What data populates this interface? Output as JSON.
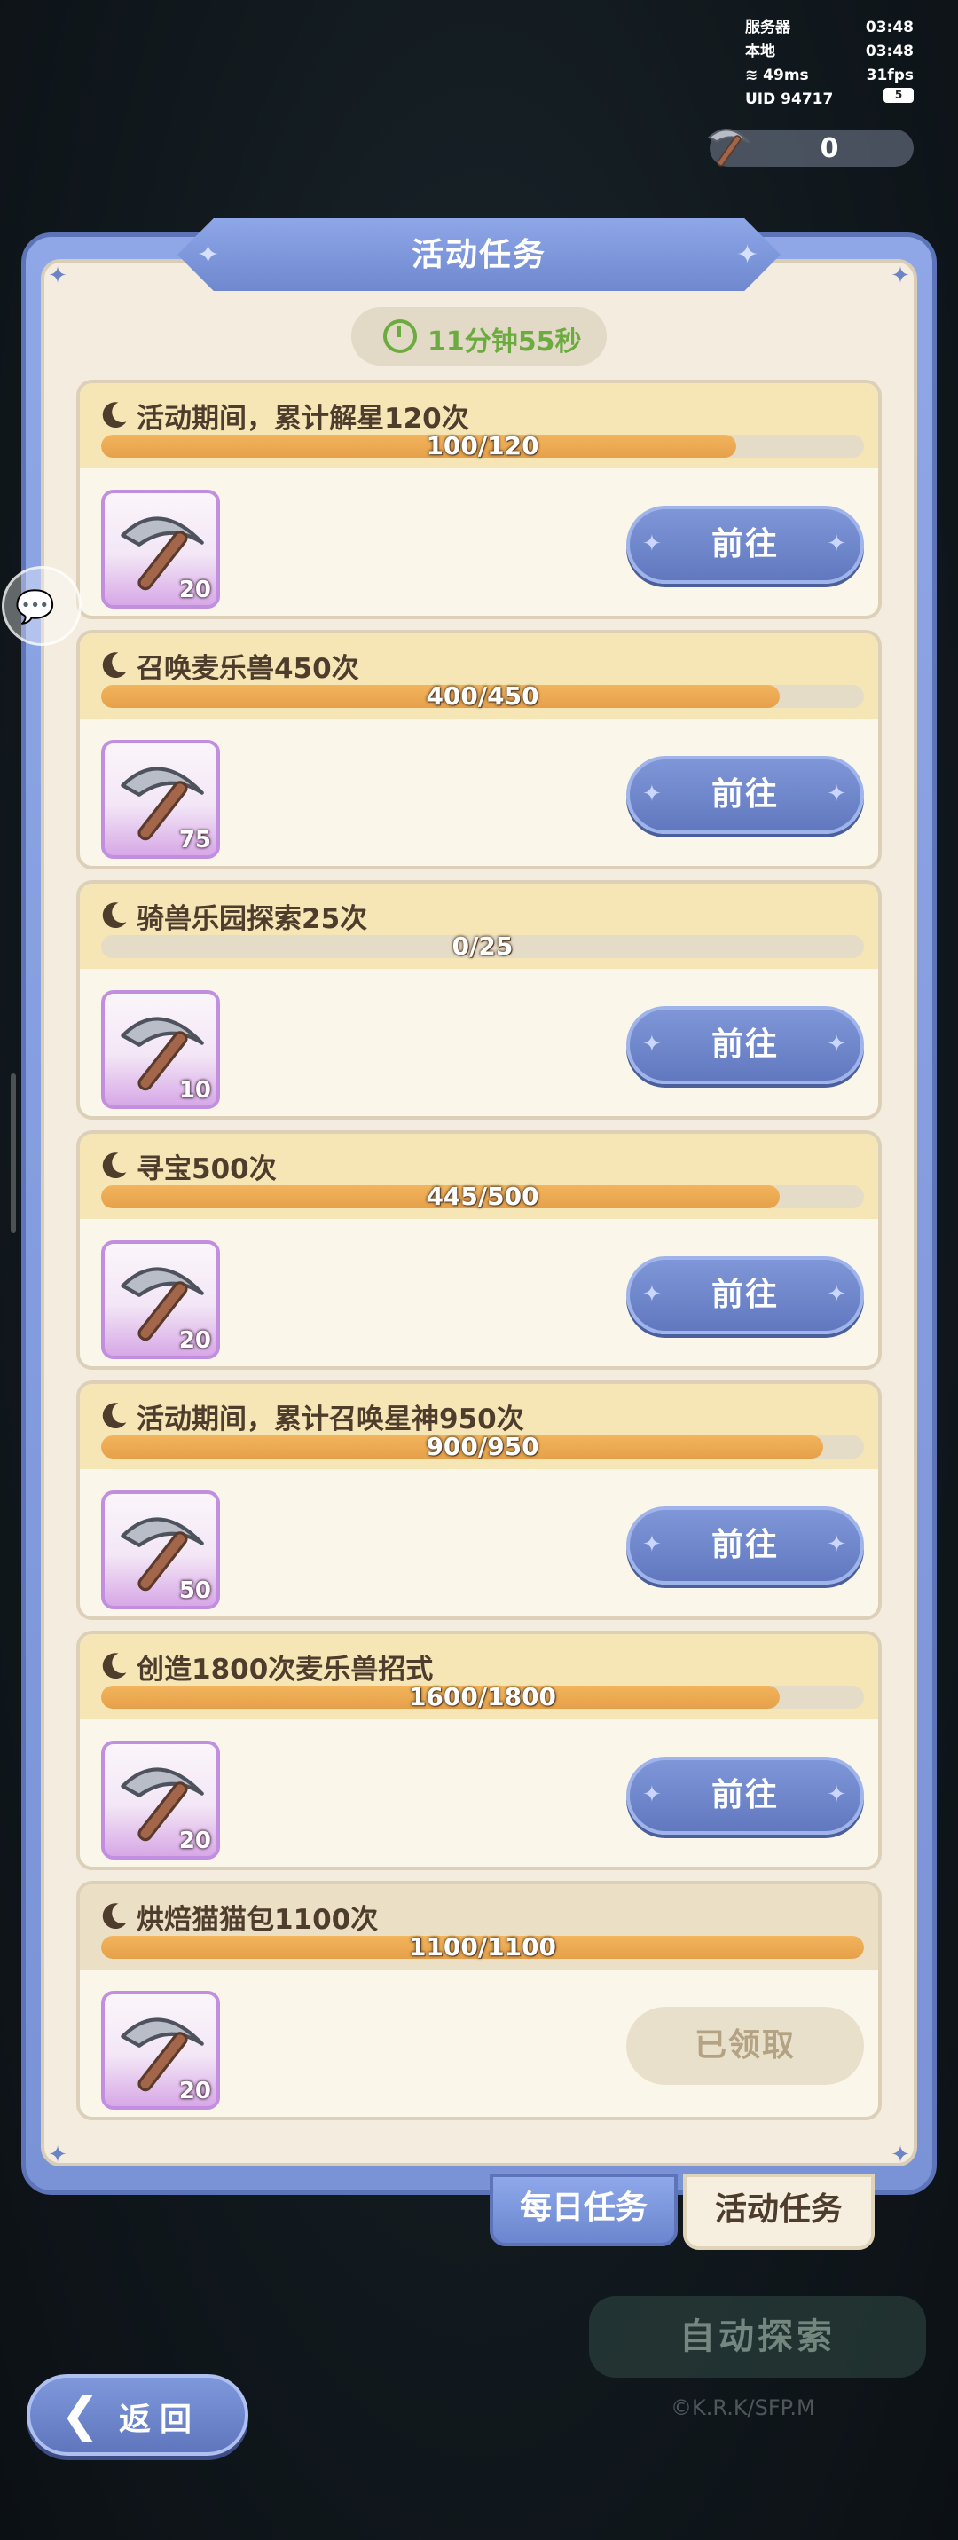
{
  "hud": {
    "server_label": "服务器",
    "server_time": "03:48",
    "local_label": "本地",
    "local_time": "03:48",
    "ping": "49ms",
    "fps": "31fps",
    "uid": "UID 94717",
    "battery": "5"
  },
  "resource": {
    "icon": "pickaxe-icon",
    "value": "0"
  },
  "panel": {
    "title": "活动任务",
    "timer": "11分钟55秒"
  },
  "tasks": [
    {
      "title": "活动期间，累计解星120次",
      "progress_text": "100/120",
      "progress": 0.833,
      "reward_icon": "pickaxe-icon",
      "reward_count": "20",
      "button": "前往",
      "claimed": false
    },
    {
      "title": "召唤麦乐兽450次",
      "progress_text": "400/450",
      "progress": 0.889,
      "reward_icon": "pickaxe-icon",
      "reward_count": "75",
      "button": "前往",
      "claimed": false
    },
    {
      "title": "骑兽乐园探索25次",
      "progress_text": "0/25",
      "progress": 0.0,
      "reward_icon": "pickaxe-icon",
      "reward_count": "10",
      "button": "前往",
      "claimed": false
    },
    {
      "title": "寻宝500次",
      "progress_text": "445/500",
      "progress": 0.89,
      "reward_icon": "pickaxe-icon",
      "reward_count": "20",
      "button": "前往",
      "claimed": false
    },
    {
      "title": "活动期间，累计召唤星神950次",
      "progress_text": "900/950",
      "progress": 0.947,
      "reward_icon": "pickaxe-icon",
      "reward_count": "50",
      "button": "前往",
      "claimed": false
    },
    {
      "title": "创造1800次麦乐兽招式",
      "progress_text": "1600/1800",
      "progress": 0.889,
      "reward_icon": "pickaxe-icon",
      "reward_count": "20",
      "button": "前往",
      "claimed": false
    },
    {
      "title": "烘焙猫猫包1100次",
      "progress_text": "1100/1100",
      "progress": 1.0,
      "reward_icon": "pickaxe-icon",
      "reward_count": "20",
      "button": "已领取",
      "claimed": true
    }
  ],
  "tabs": {
    "daily": "每日任务",
    "event": "活动任务"
  },
  "auto_explore": "自动探索",
  "copyright": "©K.R.K/SFP.M",
  "back": "返回",
  "colors": {
    "panel_blue": "#7a93d6",
    "progress_orange": "#e6a04a",
    "timer_green": "#6cab3f",
    "card_bg": "#fbf6ea"
  }
}
